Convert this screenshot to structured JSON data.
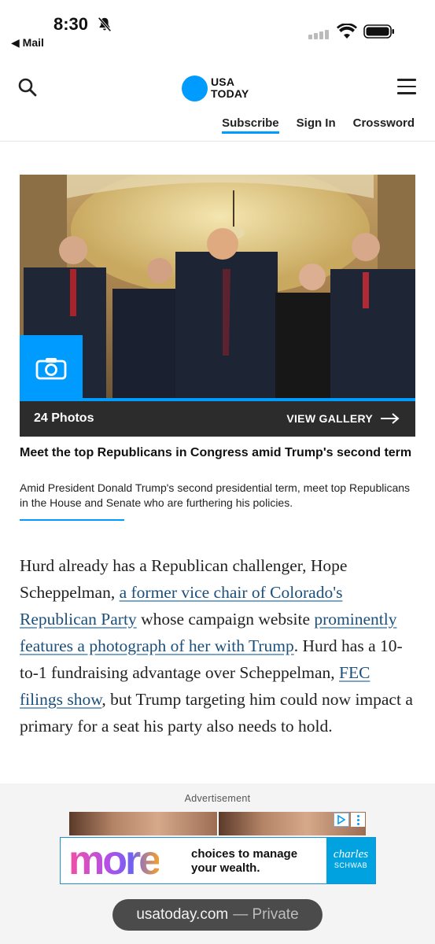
{
  "status_bar": {
    "time": "8:30",
    "back_app": "◀ Mail"
  },
  "header": {
    "logo_line1": "USA",
    "logo_line2": "TODAY",
    "nav": [
      "Subscribe",
      "Sign In",
      "Crossword"
    ],
    "accent_color": "#009bff"
  },
  "gallery": {
    "photo_count": "24 Photos",
    "view_label": "VIEW GALLERY",
    "title": "Meet the top Republicans in Congress amid Trump's second term",
    "caption": "Amid President Donald Trump's second presidential term, meet top Republicans in the House and Senate who are furthering his policies."
  },
  "article": {
    "p1_t1": "Hurd already has a Republican challenger, Hope Scheppelman, ",
    "p1_link1": "a former vice chair of Colorado's Republican Party",
    "p1_t2": " whose campaign website ",
    "p1_link2": "prominently features a photograph of her with Trump",
    "p1_t3": ". Hurd has a 10-to-1 fundraising advantage over Scheppelman, ",
    "p1_link3": "FEC filings show",
    "p1_t4": ", but Trump targeting him could now impact a primary for a seat his party also needs to hold."
  },
  "ad": {
    "label": "Advertisement",
    "headline": "more",
    "line1": "choices to manage",
    "line2": "your wealth.",
    "brand1": "charles",
    "brand2": "SCHWAB"
  },
  "url_bar": {
    "domain": "usatoday.com",
    "mode": "— Private"
  }
}
